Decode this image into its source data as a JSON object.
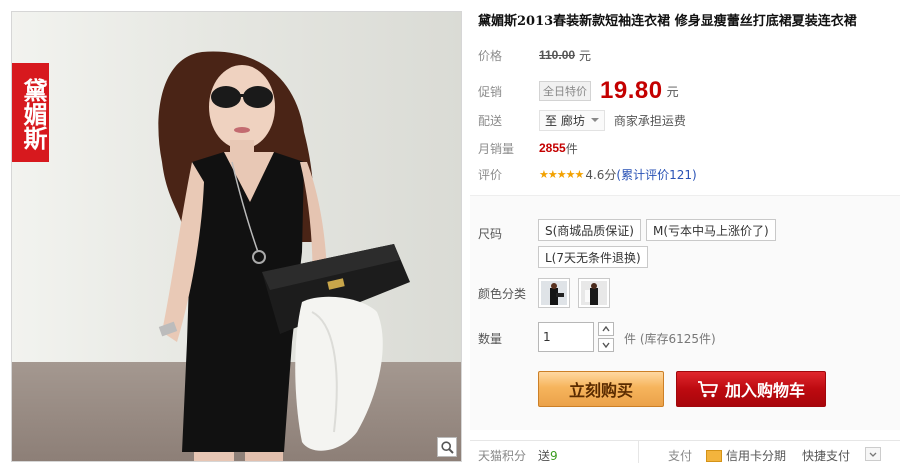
{
  "product": {
    "brand_tag": "黛媚斯",
    "title": "黛媚斯2013春装新款短袖连衣裙 修身显瘦蕾丝打底裙夏装连衣裙"
  },
  "price": {
    "label": "价格",
    "original": "110.00",
    "unit": "元"
  },
  "promo": {
    "label": "促销",
    "tag": "全日特价",
    "price": "19.80",
    "unit": "元"
  },
  "shipping": {
    "label": "配送",
    "destination": "至 廊坊",
    "note": "商家承担运费"
  },
  "sales": {
    "label": "月销量",
    "count": "2855",
    "unit": "件"
  },
  "rating": {
    "label": "评价",
    "stars": "★★★★★",
    "score": "4.6分",
    "reviews": "(累计评价121)"
  },
  "options": {
    "size_label": "尺码",
    "sizes": [
      "S(商城品质保证)",
      "M(亏本中马上涨价了)",
      "L(7天无条件退换)"
    ],
    "color_label": "颜色分类",
    "quantity_label": "数量",
    "quantity_value": "1",
    "stock_text": "件 (库存6125件)"
  },
  "actions": {
    "buy_now": "立刻购买",
    "add_to_cart": "加入购物车"
  },
  "footer": {
    "points_label": "天猫积分",
    "points_prefix": "送",
    "points_value": "9",
    "pay_label": "支付",
    "pay_card": "信用卡分期",
    "pay_quick": "快捷支付"
  },
  "colors": {
    "promo_red": "#c40000",
    "brand_red": "#d7191e",
    "buy_orange": "#f6b45c",
    "cart_red": "#bd0a10"
  },
  "icons": [
    "zoom-icon",
    "cart-icon",
    "credit-card-icon",
    "chevron-down-icon",
    "plus-icon",
    "minus-icon"
  ]
}
